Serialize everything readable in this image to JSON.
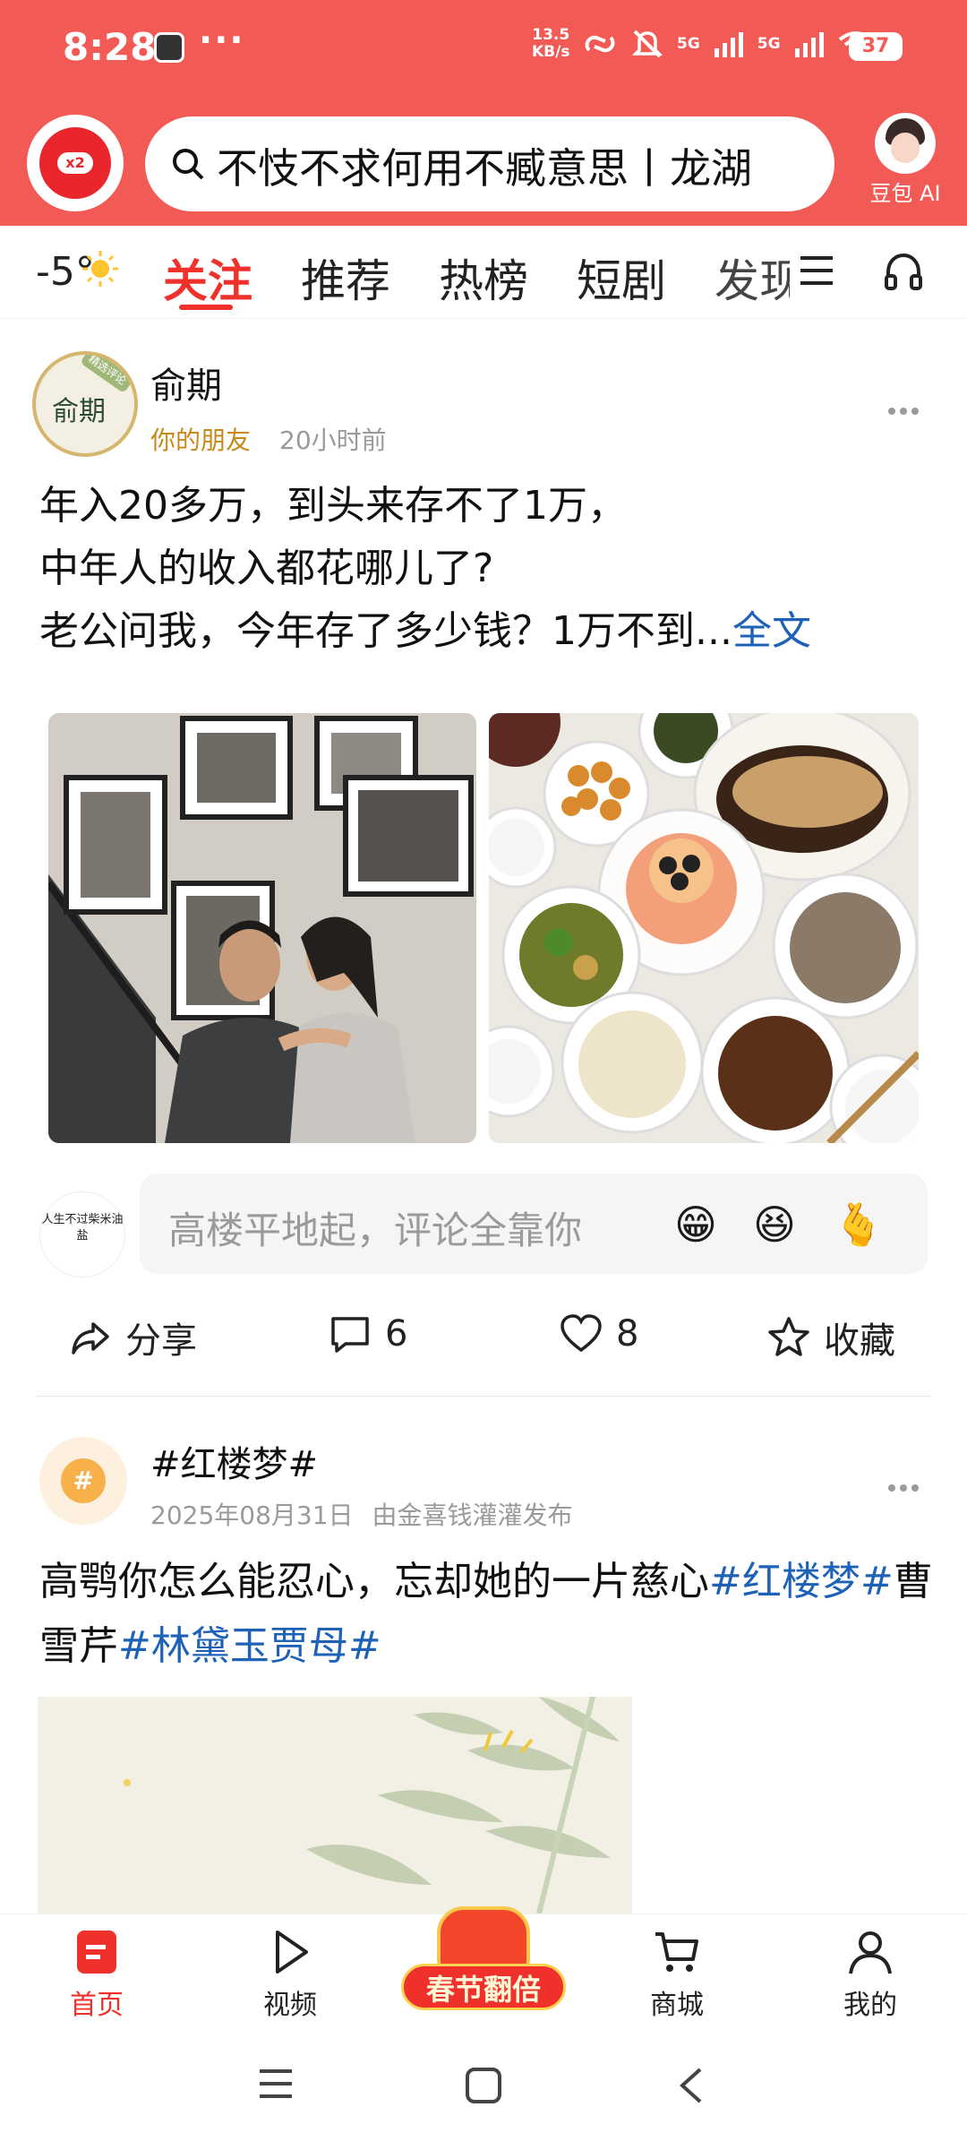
{
  "status_bar": {
    "time": "8:28",
    "more": "···",
    "net_speed_value": "13.5",
    "net_speed_unit": "KB/s",
    "signal1": "5G",
    "signal2": "5G",
    "battery": "37"
  },
  "header": {
    "logo_badge": "x2",
    "search_text": "不忮不求何用不臧意思丨龙湖",
    "ai_label": "豆包 AI"
  },
  "tabs": {
    "weather": "-5°",
    "items": [
      "关注",
      "推荐",
      "热榜",
      "短剧",
      "发现"
    ],
    "active_index": 0
  },
  "post1": {
    "avatar_text": "俞期",
    "avatar_tag": "精选评论",
    "author": "俞期",
    "relation": "你的朋友",
    "time": "20小时前",
    "line1": "年入20多万，到头来存不了1万，",
    "line2": "中年人的收入都花哪儿了?",
    "line3": "老公问我，今年存了多少钱？1万不到...",
    "read_more": "全文",
    "comment_avatar_text": "人生不过柴米油盐",
    "comment_placeholder": "高楼平地起，评论全靠你",
    "emojis": [
      "😁",
      "😆",
      "🫰"
    ],
    "share_label": "分享",
    "comment_count": "6",
    "like_count": "8",
    "favorite_label": "收藏"
  },
  "post2": {
    "avatar_text": "#",
    "title": "#红楼梦#",
    "date": "2025年08月31日",
    "publisher": "由金喜钱灌灌发布",
    "text": "高鹗你怎么能忍心，忘却她的一片慈心",
    "tag1": "#红楼梦#",
    "text_mid": "曹雪芹",
    "tag2": "#林黛玉贾母#"
  },
  "bottom_nav": {
    "home": "首页",
    "video": "视频",
    "promo": "春节翻倍",
    "mall": "商城",
    "mine": "我的"
  },
  "colors": {
    "brand_red": "#f15a55",
    "active_red": "#f0302a",
    "link_blue": "#1e62b8",
    "friend_gold": "#c58a18"
  }
}
